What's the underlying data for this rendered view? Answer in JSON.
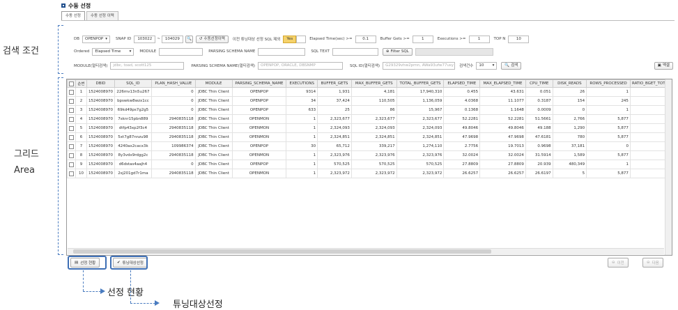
{
  "page": {
    "title": "수동 선정"
  },
  "tabs": [
    {
      "label": "수동 선정"
    },
    {
      "label": "수동 선정 이력"
    }
  ],
  "annotations": {
    "search_conditions": "검색 조건",
    "grid_line1": "그리드",
    "grid_line2": "Area",
    "selection_status": "선정 현황",
    "tuning_target": "튜닝대상선정"
  },
  "search": {
    "db_label": "DB",
    "db_value": "OPENPOP",
    "snap_id_label": "SNAP ID",
    "snap_from": "103022",
    "snap_tilde": "~",
    "snap_to": "104029",
    "manual_history_button": "수동선정이력",
    "exclude_label": "이전 튜닝대상 선정 SQL 제외",
    "exclude_value": "Yes",
    "elapsed_label": "Elapsed Time(sec) >=",
    "elapsed_value": "0.1",
    "buffer_label": "Buffer Gets >=",
    "buffer_value": "1",
    "exec_label": "Executions >=",
    "exec_value": "1",
    "topn_label": "TOP N",
    "topn_value": "10",
    "ordered_label": "Ordered",
    "ordered_value": "Elapsed Time",
    "module_label": "MODULE",
    "schema_label": "PARSING SCHEMA NAME",
    "sqltext_label": "SQL TEXT",
    "filter_sql_button": "Filter SQL",
    "module_multi_label": "MODULE(멀티검색)",
    "module_multi_placeholder": "jdbc, toad, scott125",
    "schema_multi_label": "PARSING SCHEMA NAME(멀티검색)",
    "schema_multi_placeholder": "OPENPOP, ORACLE, DBSNMP",
    "sqlid_multi_label": "SQL ID(멀티검색)",
    "sqlid_multi_placeholder": "G29329vhw2prnn, AWa93ufw77usy",
    "count_label": "검색건수",
    "count_value": "10",
    "search_button": "검색",
    "excel_button": "엑셀"
  },
  "grid": {
    "columns": [
      "",
      "순번",
      "DBID",
      "SQL_ID",
      "PLAN_HASH_VALUE",
      "MODULE",
      "PARSING_SCHEMA_NAME",
      "EXECUTIONS",
      "BUFFER_GETS",
      "MAX_BUFFER_GETS",
      "TOTAL_BUFFER_GETS",
      "ELAPSED_TIME",
      "MAX_ELAPSED_TIME",
      "CPU_TIME",
      "DISK_READS",
      "ROWS_PROCESSED",
      "RATIO_BGET_TOTAL"
    ],
    "rows": [
      [
        "1",
        "1524008970",
        "226mv13n5u267",
        "0",
        "JDBC Thin Client",
        "OPENPOP",
        "9314",
        "1,931",
        "4,181",
        "17,940,310",
        "0.455",
        "43.631",
        "0.051",
        "26",
        "1",
        ""
      ],
      [
        "2",
        "1524008970",
        "bpswkw8wzx1cc",
        "0",
        "JDBC Thin Client",
        "OPENPOP",
        "34",
        "37,424",
        "110,505",
        "1,136,059",
        "4.0368",
        "11.1077",
        "0.3187",
        "154",
        "245",
        ""
      ],
      [
        "3",
        "1524008970",
        "69kd49ps7g2g5",
        "0",
        "JDBC Thin Client",
        "OPENPOP",
        "633",
        "25",
        "86",
        "15,967",
        "0.1368",
        "1.1648",
        "0.0009",
        "0",
        "1",
        ""
      ],
      [
        "4",
        "1524008970",
        "7sknr15pbn889",
        "2940835118",
        "JDBC Thin Client",
        "OPENMON",
        "1",
        "2,323,677",
        "2,323,677",
        "2,323,677",
        "52.2281",
        "52.2281",
        "51.5661",
        "2,766",
        "5,877",
        ""
      ],
      [
        "5",
        "1524008970",
        "dtfp43xp2f3c4",
        "2940835118",
        "JDBC Thin Client",
        "OPENMON",
        "1",
        "2,324,093",
        "2,324,093",
        "2,324,093",
        "49.8046",
        "49.8046",
        "49.188",
        "1,290",
        "5,877",
        ""
      ],
      [
        "6",
        "1524008970",
        "5xt7g87nnzu98",
        "2940835118",
        "JDBC Thin Client",
        "OPENMON",
        "1",
        "2,324,851",
        "2,324,851",
        "2,324,851",
        "47.9698",
        "47.9698",
        "47.6181",
        "780",
        "5,877",
        ""
      ],
      [
        "7",
        "1524008970",
        "4240ax2cacx3k",
        "109986374",
        "JDBC Thin Client",
        "OPENPOP",
        "30",
        "65,712",
        "339,217",
        "1,274,110",
        "2.7756",
        "19.7013",
        "0.9698",
        "37,181",
        "0",
        ""
      ],
      [
        "8",
        "1524008970",
        "8y3vdx9rdgg2c",
        "2940835118",
        "JDBC Thin Client",
        "OPENMON",
        "1",
        "2,323,976",
        "2,323,976",
        "2,323,976",
        "32.0024",
        "32.0024",
        "31.5914",
        "1,589",
        "5,877",
        ""
      ],
      [
        "9",
        "1524008970",
        "d6dstas4aajh4",
        "0",
        "JDBC Thin Client",
        "OPENPOP",
        "1",
        "570,525",
        "570,525",
        "570,525",
        "27.8809",
        "27.8809",
        "20.939",
        "480,349",
        "1",
        ""
      ],
      [
        "10",
        "1524008970",
        "2sj201gd7r1ma",
        "2940835118",
        "JDBC Thin Client",
        "OPENMON",
        "1",
        "2,323,972",
        "2,323,972",
        "2,323,972",
        "26.6257",
        "26.6257",
        "26.6197",
        "5",
        "5,877",
        ""
      ]
    ]
  },
  "footer": {
    "status_button": "선정 현황",
    "tuning_button": "튜닝대상선정",
    "prev_button": "이전",
    "next_button": "다음"
  }
}
